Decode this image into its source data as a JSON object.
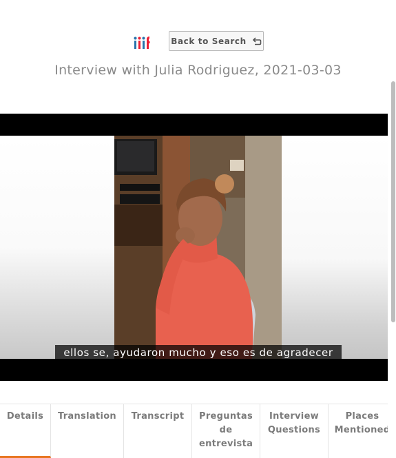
{
  "header": {
    "back_label": "Back to Search",
    "title": "Interview with Julia Rodriguez, 2021-03-03"
  },
  "video": {
    "subtitle": "ellos se, ayudaron mucho y eso es de agradecer"
  },
  "tabs": [
    {
      "label": "Details",
      "active": true
    },
    {
      "label": "Translation",
      "active": false
    },
    {
      "label": "Transcript",
      "active": false
    },
    {
      "label": "Preguntas de entrevista",
      "active": false
    },
    {
      "label": "Interview Questions",
      "active": false
    },
    {
      "label": "Places Mentioned",
      "active": false
    }
  ],
  "colors": {
    "accent": "#e87722",
    "iiif_blue": "#2873ab",
    "iiif_red": "#ed1d33",
    "sweater": "#e8614f"
  },
  "icons": {
    "logo": "iiif-logo-icon",
    "back": "return-arrow-icon"
  }
}
